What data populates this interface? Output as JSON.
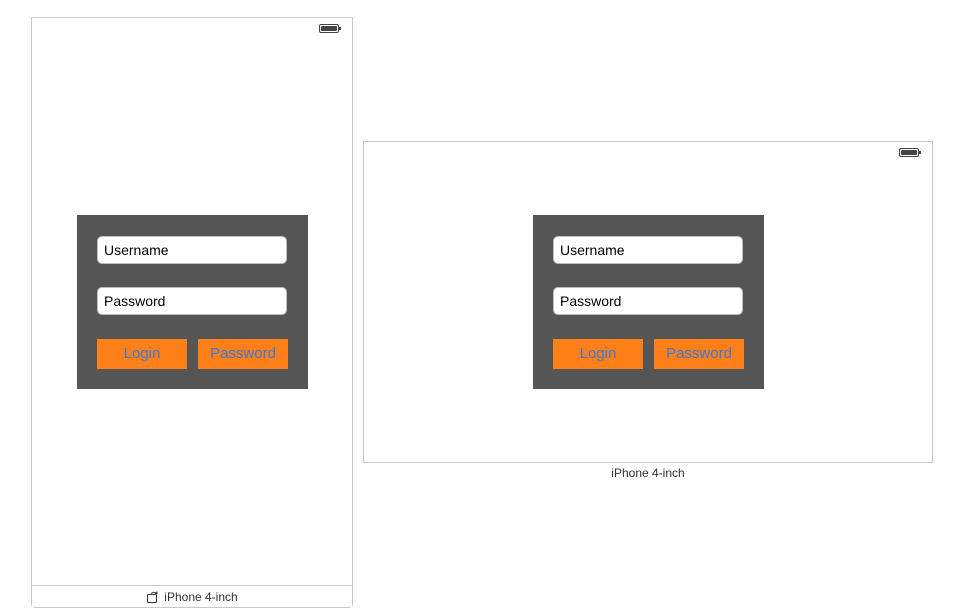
{
  "canvas": {
    "portrait": {
      "username_placeholder": "Username",
      "password_placeholder": "Password",
      "login_button": "Login",
      "password_button": "Password",
      "device_label": "iPhone 4-inch",
      "icons": [
        "battery-icon",
        "rotate-icon"
      ]
    },
    "landscape": {
      "username_placeholder": "Username",
      "password_placeholder": "Password",
      "login_button": "Login",
      "password_button": "Password",
      "device_label": "iPhone 4-inch",
      "icons": [
        "battery-icon"
      ]
    }
  },
  "colors": {
    "panel_background": "#555555",
    "button_background": "#ff7f18",
    "button_text": "#3b78d9",
    "field_background": "#ffffff"
  }
}
